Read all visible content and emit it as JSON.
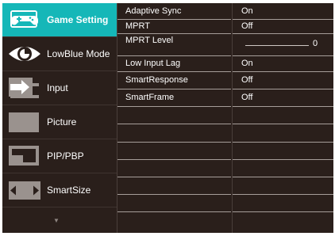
{
  "menu": {
    "items": [
      {
        "label": "Game Setting",
        "icon": "gamepad-icon",
        "active": true
      },
      {
        "label": "LowBlue Mode",
        "icon": "eye-icon",
        "active": false
      },
      {
        "label": "Input",
        "icon": "input-icon",
        "active": false
      },
      {
        "label": "Picture",
        "icon": "picture-icon",
        "active": false
      },
      {
        "label": "PIP/PBP",
        "icon": "pip-pbp-icon",
        "active": false
      },
      {
        "label": "SmartSize",
        "icon": "smartsize-icon",
        "active": false
      }
    ],
    "more_indicator": "▼"
  },
  "settings": [
    {
      "label": "Adaptive Sync",
      "value": "On"
    },
    {
      "label": "MPRT",
      "value": "Off"
    },
    {
      "label": "MPRT Level",
      "value": "0",
      "slider_level": 0
    },
    {
      "label": "Low Input Lag",
      "value": "On"
    },
    {
      "label": "SmartResponse",
      "value": "Off"
    },
    {
      "label": "SmartFrame",
      "value": "Off"
    }
  ],
  "colors": {
    "background": "#2a1f1b",
    "accent": "#15b7b8",
    "text": "#ffffff",
    "icon_gray": "#9a928e"
  }
}
